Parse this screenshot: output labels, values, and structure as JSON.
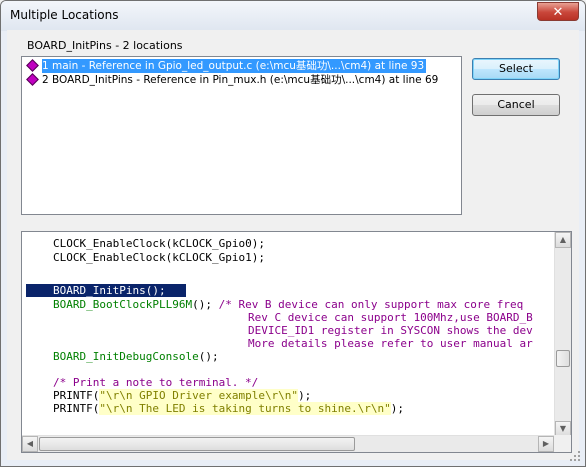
{
  "window": {
    "title": "Multiple Locations"
  },
  "group": {
    "label": "BOARD_InitPins - 2 locations"
  },
  "locations": [
    {
      "text": "1 main - Reference in Gpio_led_output.c (e:\\mcu基础功\\...\\cm4) at line 93",
      "selected": true
    },
    {
      "text": "2 BOARD_InitPins - Reference in Pin_mux.h (e:\\mcu基础功\\...\\cm4) at line 69",
      "selected": false
    }
  ],
  "buttons": {
    "select": "Select",
    "cancel": "Cancel"
  },
  "code": {
    "l1": {
      "fn": "CLOCK_EnableClock",
      "arg": "kCLOCK_Gpio0"
    },
    "l2": {
      "fn": "CLOCK_EnableClock",
      "arg": "kCLOCK_Gpio1"
    },
    "l4": "BOARD_InitPins();",
    "l5": {
      "fn": "BOARD_BootClockPLL96M",
      "rest": "(); ",
      "comment": "/* Rev B device can only support max core freq"
    },
    "l6": "Rev C device can support 100Mhz,use BOARD_B",
    "l7": "DEVICE_ID1 register in SYSCON shows the dev",
    "l8": "More details please refer to user manual ar",
    "l9": {
      "fn": "BOARD_InitDebugConsole",
      "rest": "();"
    },
    "l11": "/* Print a note to terminal. */",
    "l12": {
      "fn": "PRINTF",
      "str": "\"\\r\\n GPIO Driver example\\r\\n\"",
      "end": ");"
    },
    "l13": {
      "fn": "PRINTF",
      "str": "\"\\r\\n The LED is taking turns to shine.\\r\\n\"",
      "end": ");"
    }
  },
  "icons": {
    "close": "close-icon",
    "location": "diamond-icon"
  }
}
